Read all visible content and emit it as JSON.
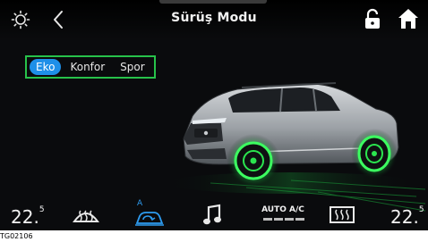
{
  "header": {
    "title": "Sürüş Modu",
    "brightness_icon": "brightness-icon",
    "back_icon": "chevron-left-icon",
    "lock_icon": "unlock-icon",
    "home_icon": "home-icon"
  },
  "drive_modes": {
    "options": [
      "Eko",
      "Konfor",
      "Spor"
    ],
    "selected": "Eko"
  },
  "vehicle": {
    "image": "suv-car-image"
  },
  "climate": {
    "left_temp": "22",
    "left_temp_decimal": "5",
    "right_temp": "22",
    "right_temp_decimal": "5",
    "auto_ac_label": "AUTO A/C",
    "recirc_mode_label": "A",
    "icons": [
      "front-defrost-icon",
      "recirculation-icon",
      "music-icon",
      "auto-ac-icon",
      "rear-defrost-icon"
    ]
  },
  "caption": "TG02106",
  "colors": {
    "accent": "#1e8fe8",
    "frame": "#27c24a",
    "wheel_glow": "#39ff5a",
    "background": "#0a0b0d"
  }
}
